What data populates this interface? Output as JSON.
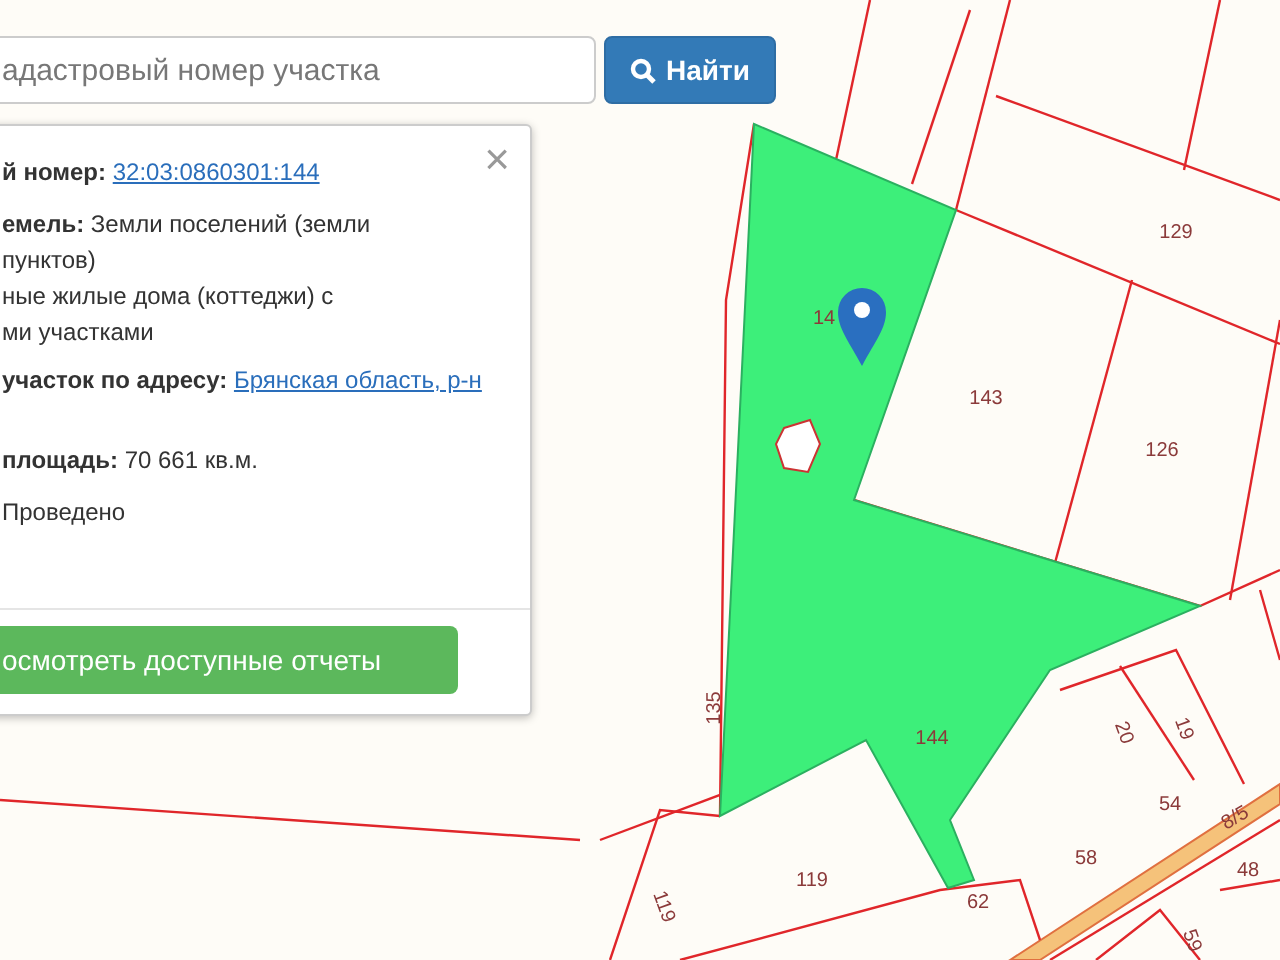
{
  "search": {
    "placeholder": "адастровый номер участка",
    "button": "Найти"
  },
  "info_panel": {
    "close": "×",
    "rows": [
      {
        "kind": "link",
        "label": "й номер:",
        "value": "32:03:0860301:144"
      },
      {
        "kind": "lines",
        "lines": [
          "**емель:** Земли поселений (земли",
          "пунктов)",
          "ные жилые дома (коттеджи) с",
          "ми участками"
        ]
      },
      {
        "kind": "link",
        "label": "участок по адресу:",
        "value": "Брянская область, р-н"
      },
      {
        "kind": "text",
        "label": "площадь:",
        "value": "70 661 кв.м."
      },
      {
        "kind": "text",
        "label": "",
        "value": "Проведено"
      }
    ],
    "button": "осмотреть доступные отчеты"
  },
  "map": {
    "parcel_labels": [
      "129",
      "143",
      "126",
      "14",
      "135",
      "144",
      "20",
      "19",
      "54",
      "8/5",
      "58",
      "119",
      "119",
      "62",
      "48",
      "59"
    ]
  }
}
